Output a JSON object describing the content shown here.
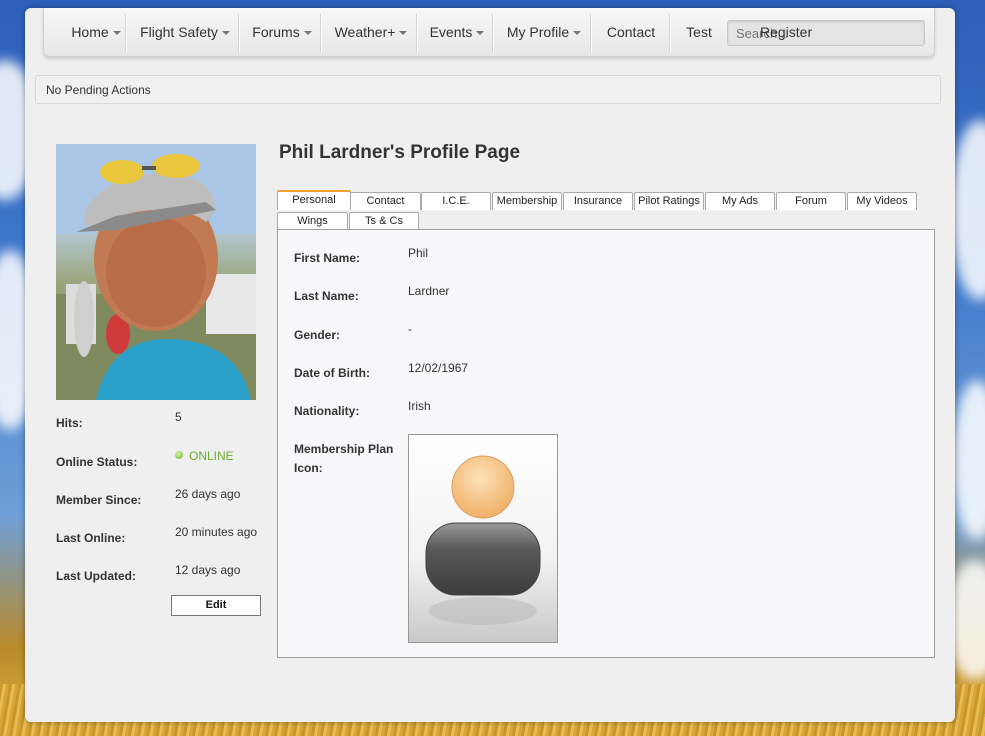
{
  "nav": {
    "items": [
      {
        "label": "Home",
        "dropdown": true
      },
      {
        "label": "Flight Safety",
        "dropdown": true
      },
      {
        "label": "Forums",
        "dropdown": true
      },
      {
        "label": "Weather+",
        "dropdown": true
      },
      {
        "label": "Events",
        "dropdown": true
      },
      {
        "label": "My Profile",
        "dropdown": true
      },
      {
        "label": "Contact",
        "dropdown": false
      },
      {
        "label": "Test",
        "dropdown": false
      }
    ],
    "register_label": "Register",
    "search_placeholder": "Search..."
  },
  "pending": {
    "text": "No Pending Actions"
  },
  "profile": {
    "title": "Phil Lardner's Profile Page",
    "stats": [
      {
        "label": "Hits:",
        "value": "5"
      },
      {
        "label": "Online Status:",
        "value": "ONLINE"
      },
      {
        "label": "Member Since:",
        "value": "26 days ago"
      },
      {
        "label": "Last Online:",
        "value": "20 minutes ago"
      },
      {
        "label": "Last Updated:",
        "value": "12 days ago"
      }
    ],
    "edit_label": "Edit"
  },
  "tabs": [
    {
      "label": "Personal",
      "active": true
    },
    {
      "label": "Contact"
    },
    {
      "label": "I.C.E."
    },
    {
      "label": "Membership"
    },
    {
      "label": "Insurance"
    },
    {
      "label": "Pilot Ratings"
    },
    {
      "label": "My Ads"
    },
    {
      "label": "Forum"
    },
    {
      "label": "My Videos"
    },
    {
      "label": "Wings"
    },
    {
      "label": "Ts & Cs"
    }
  ],
  "personal": {
    "fields": [
      {
        "label": "First Name:",
        "value": "Phil"
      },
      {
        "label": "Last Name:",
        "value": "Lardner"
      },
      {
        "label": "Gender:",
        "value": "-"
      },
      {
        "label": "Date of Birth:",
        "value": "12/02/1967"
      },
      {
        "label": "Nationality:",
        "value": "Irish"
      }
    ],
    "plan_icon_label": "Membership Plan Icon:"
  },
  "colors": {
    "online": "#6aae2a",
    "active_tab": "#f0a030"
  }
}
